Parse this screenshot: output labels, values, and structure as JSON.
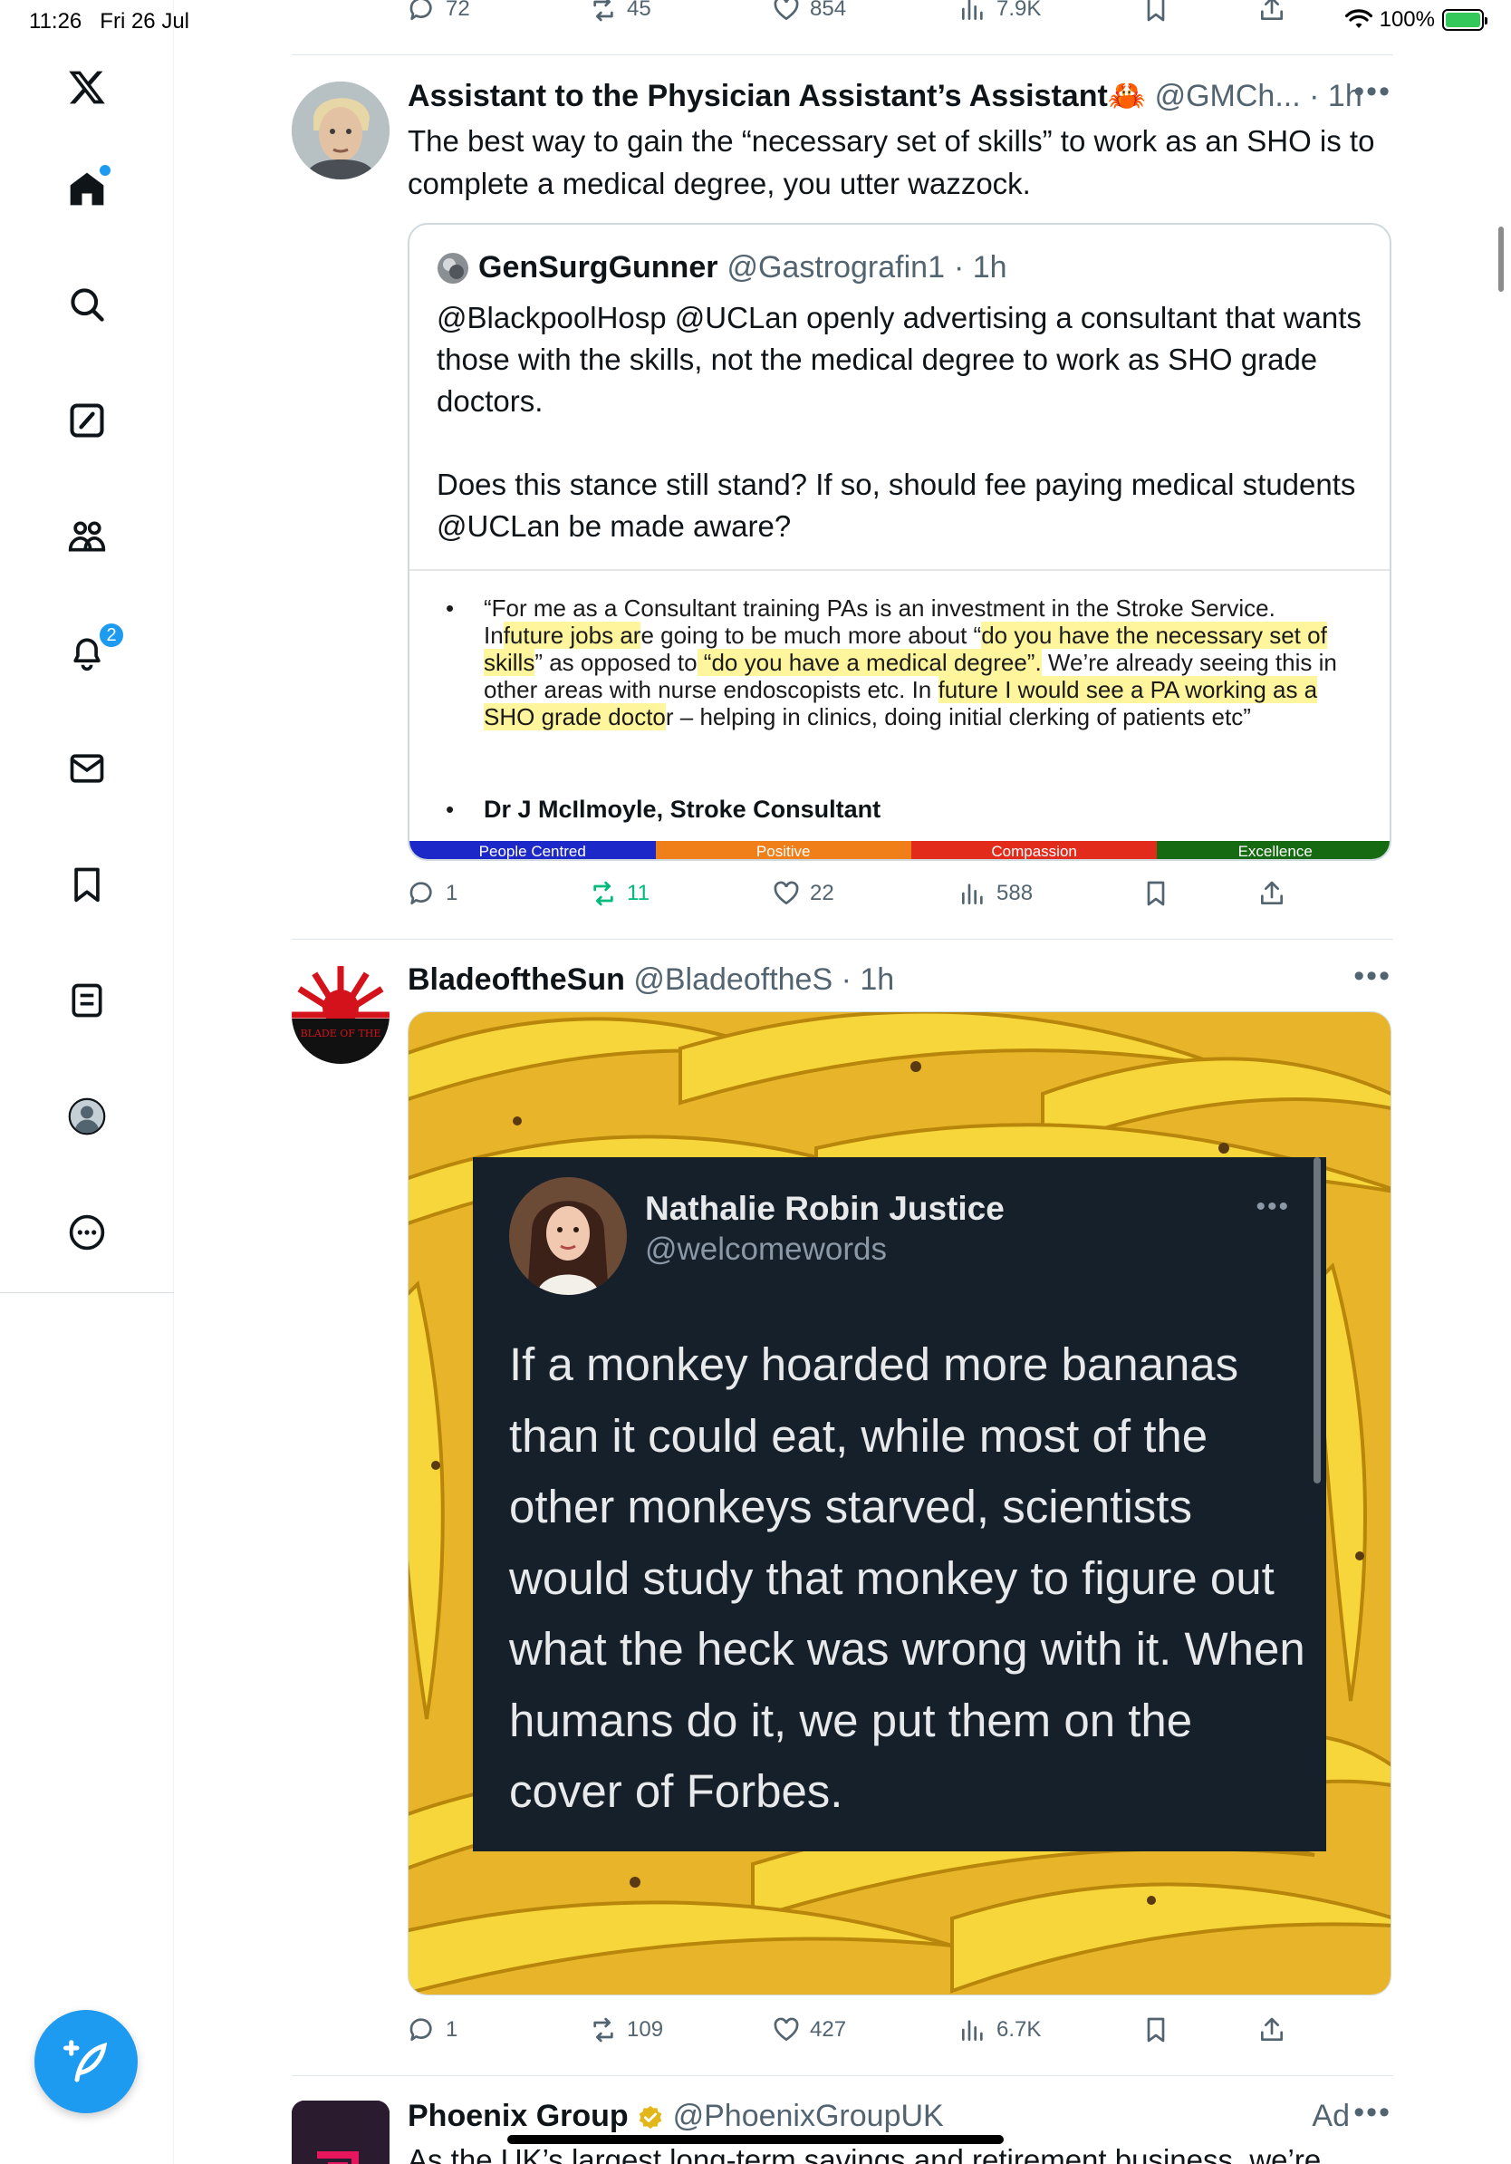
{
  "status_bar": {
    "time": "11:26",
    "date": "Fri 26 Jul",
    "battery": "100%"
  },
  "sidebar": {
    "notifications_badge": "2"
  },
  "top_actions": {
    "replies": "72",
    "reposts": "45",
    "likes": "854",
    "views": "7.9K"
  },
  "tweet1": {
    "name": "Assistant to the Physician Assistant’s Assistant",
    "emoji": "🦀",
    "handle": "@GMCh...",
    "time": "· 1h",
    "text": "The best way to gain the “necessary set of skills” to work as an SHO is to complete a medical degree, you utter wazzock.",
    "quote": {
      "name": "GenSurgGunner",
      "handle": "@Gastrografin1",
      "time": "· 1h",
      "text_p1": "@BlackpoolHosp @UCLan openly advertising a consultant that wants those with the skills, not the medical degree to work as SHO grade doctors.",
      "text_p2": "Does this stance still stand? If so, should fee paying medical students @UCLan be made aware?",
      "doc": {
        "q1": "“For me as a Consultant training PAs is an investment in the Stroke Service.  In",
        "h1": "future jobs ar",
        "q2": "e going to be much more about “",
        "h2": "do you have the necessary set of skills",
        "q3": "” as opposed to",
        "h3": " “do you have a medical degree”.",
        "q4": "  We’re already seeing this in other areas with nurse endoscopists etc.  In ",
        "h4": "future I would see a PA working as a SHO grade docto",
        "q5": "r – helping in clinics, doing initial clerking of patients etc”",
        "signature": "Dr J McIlmoyle, Stroke Consultant",
        "bar": [
          {
            "label": "People Centred",
            "color": "#1d28c8"
          },
          {
            "label": "Positive",
            "color": "#f07f1a"
          },
          {
            "label": "Compassion",
            "color": "#e32b1c"
          },
          {
            "label": "Excellence",
            "color": "#166a12"
          }
        ]
      }
    },
    "actions": {
      "replies": "1",
      "reposts": "11",
      "likes": "22",
      "views": "588"
    }
  },
  "tweet2": {
    "name": "BladeoftheSun",
    "handle": "@BladeoftheS",
    "time": "· 1h",
    "avatar_text": "BLADE OF THE",
    "image": {
      "name": "Nathalie Robin Justice",
      "handle": "@welcomewords",
      "text": "If a monkey hoarded more bananas than it could eat, while most of the other monkeys starved, scientists would study that monkey to figure out what the heck was wrong with it. When humans do it, we put them on the cover of Forbes."
    },
    "actions": {
      "replies": "1",
      "reposts": "109",
      "likes": "427",
      "views": "6.7K"
    }
  },
  "tweet3": {
    "name": "Phoenix Group",
    "handle": "@PhoenixGroupUK",
    "ad_label": "Ad",
    "text": "As the UK’s largest long-term savings and retirement business, we’re"
  },
  "colors": {
    "accent": "#1d9bf0",
    "repost_active": "#00ba7c",
    "text": "#0f1419",
    "muted": "#536471"
  }
}
